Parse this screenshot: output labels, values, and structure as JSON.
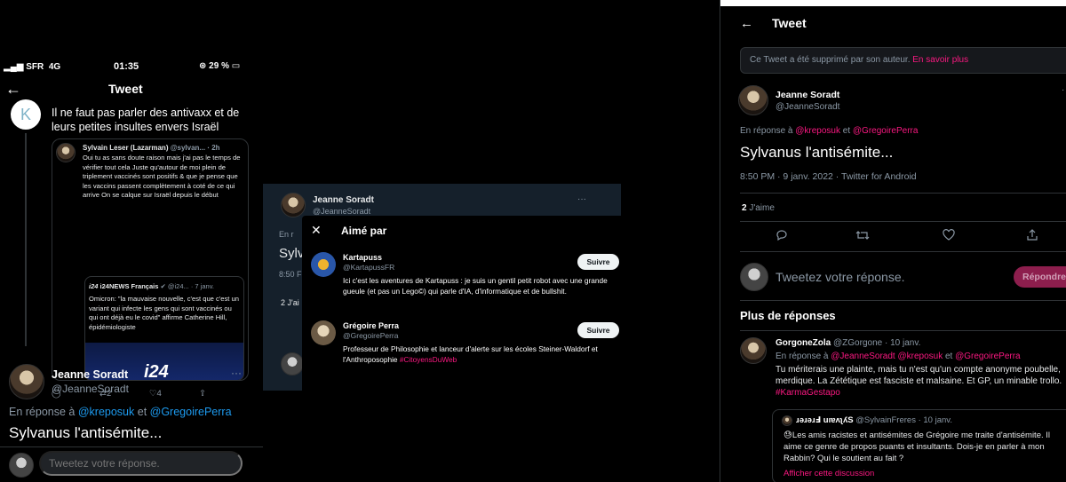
{
  "colors": {
    "link_blue": "#1d9bf0",
    "link_pink": "#f91880",
    "muted": "#8b98a5",
    "dim_bg": "#15202b",
    "reply_button": "#8d1e4d"
  },
  "left": {
    "status": {
      "carrier": "SFR",
      "network": "4G",
      "time": "01:35",
      "battery": "29 %"
    },
    "header": {
      "back_icon": "arrow-left-icon",
      "title": "Tweet"
    },
    "original": {
      "avatar_letter": "K",
      "text": "Il ne faut pas parler des antivaxx et de leurs petites insultes envers Israël"
    },
    "quote": {
      "author": "Sylvain Leser (Lazarman)",
      "handle_time": "@sylvan... · 2h",
      "text": "Oui tu as sans doute raison mais j'ai pas le temps de vérifier tout cela Juste qu'autour de moi plein de triplement vaccinés sont positifs & que je pense que les vaccins passent complètement à coté de ce qui arrive On se calque sur Israël depuis le début",
      "nested": {
        "author": "i24NEWS Français",
        "handle": "@i24...",
        "time": "· 7 janv.",
        "text": "Omicron: \"la mauvaise nouvelle, c'est que c'est un variant qui infecte les gens qui sont vaccinés ou qui ont déjà eu le covid\" affirme Catherine Hill, épidémiologiste",
        "media_logo": "i24"
      }
    },
    "actions": {
      "retweets": "2",
      "likes": "4"
    },
    "tweet": {
      "name": "Jeanne Soradt",
      "handle": "@JeanneSoradt",
      "reply_prefix": "En réponse à ",
      "reply_to_1": "@kreposuk",
      "reply_and": " et ",
      "reply_to_2": "@GregoirePerra",
      "text": "Sylvanus l'antisémite..."
    },
    "reply_placeholder": "Tweetez votre réponse."
  },
  "middle": {
    "name": "Jeanne Soradt",
    "handle": "@JeanneSoradt",
    "ghost_reply": "En r",
    "ghost_text": "Sylv",
    "ghost_meta": "8:50 F",
    "ghost_likes": "2 J'ai",
    "modal": {
      "title": "Aimé par",
      "likers": [
        {
          "name": "Kartapuss",
          "handle": "@KartapussFR",
          "bio": "Ici c'est les aventures de Kartapuss : je suis un gentil petit robot avec une grande gueule (et pas un Lego©) qui parle d'IA, d'informatique et de bullshit.",
          "follow": "Suivre"
        },
        {
          "name": "Grégoire Perra",
          "handle": "@GregoirePerra",
          "bio": "Professeur de Philosophie et lanceur d'alerte sur les écoles Steiner-Waldorf et l'Anthroposophie ",
          "bio_tag": "#CitoyensDuWeb",
          "follow": "Suivre"
        }
      ]
    }
  },
  "right": {
    "header": {
      "title": "Tweet"
    },
    "deleted_notice": "Ce Tweet a été supprimé par son auteur. ",
    "deleted_link": "En savoir plus",
    "tweet": {
      "name": "Jeanne Soradt",
      "handle": "@JeanneSoradt",
      "reply_prefix": "En réponse à ",
      "reply_to_1": "@kreposuk",
      "reply_and": "  et  ",
      "reply_to_2": "@GregoirePerra",
      "text": "Sylvanus l'antisémite...",
      "meta": "8:50 PM · 9 janv. 2022 · Twitter for Android",
      "likes_count": "2",
      "likes_label": " J'aime"
    },
    "reply_placeholder": "Tweetez votre réponse.",
    "reply_button": "Répondre",
    "more_replies": "Plus de réponses",
    "comment": {
      "name": "GorgoneZola",
      "handle_time": " @ZGorgone · 10 janv.",
      "reply_prefix": "En réponse à ",
      "reply_to_1": "@JeanneSoradt",
      "reply_to_2": "@kreposuk",
      "reply_and": "  et  ",
      "reply_to_3": "@GregoirePerra",
      "text": "Tu mériterais une plainte, mais tu n'est qu'un compte anonyme poubelle, merdique. La Zététique est fasciste et malsaine. Et GP, un minable trollo.",
      "hashtag": "#KarmaGestapo",
      "quote": {
        "name": "ɹǝɹǝɹℲ uıɐʌʅʎS",
        "handle_time": " @SylvainFreres · 10 janv.",
        "text": "Les amis racistes et antisémites de Grégoire me traite d'antisémite. Il aime ce genre de propos puants et insultants. Dois-je en parler à mon Rabbin? Qui le soutient au fait ?",
        "show_thread": "Afficher cette discussion"
      }
    }
  }
}
